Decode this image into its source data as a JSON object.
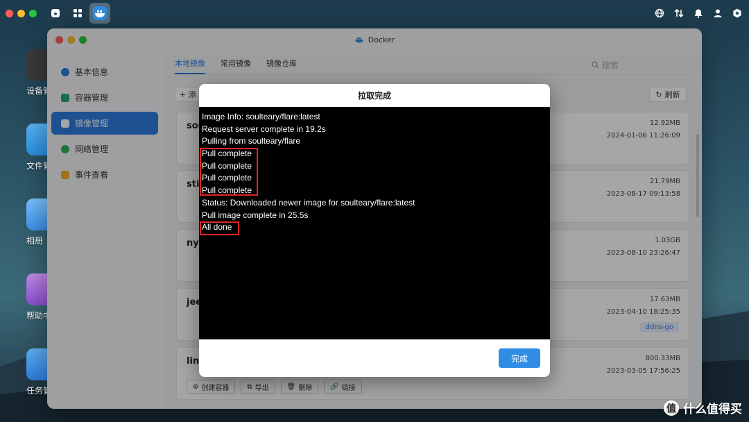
{
  "window": {
    "title": "Docker"
  },
  "desktop": {
    "icons": [
      {
        "label": "设备管"
      },
      {
        "label": "文件管"
      },
      {
        "label": "相册"
      },
      {
        "label": "帮助中"
      },
      {
        "label": "任务管"
      }
    ]
  },
  "sidebar": {
    "items": [
      {
        "label": "基本信息",
        "icon": "docker-icon"
      },
      {
        "label": "容器管理",
        "icon": "container-icon"
      },
      {
        "label": "镜像管理",
        "icon": "image-icon"
      },
      {
        "label": "网络管理",
        "icon": "network-icon"
      },
      {
        "label": "事件查看",
        "icon": "event-icon"
      }
    ]
  },
  "main": {
    "tabs": [
      {
        "label": "本地镜像"
      },
      {
        "label": "常用镜像"
      },
      {
        "label": "镜像仓库"
      }
    ],
    "search_placeholder": "搜索",
    "add_label": "添",
    "refresh_label": "刷新",
    "images": [
      {
        "name": "sou",
        "size": "12.92MB",
        "date": "2024-01-06 11:26:09",
        "tag": ""
      },
      {
        "name": "stir",
        "size": "21.79MB",
        "date": "2023-08-17 09:13:58",
        "tag": ""
      },
      {
        "name": "nya",
        "size": "1.03GB",
        "date": "2023-08-10 23:26:47",
        "tag": ""
      },
      {
        "name": "jee",
        "size": "17.63MB",
        "date": "2023-04-10 18:25:35",
        "tag": "ddns-go"
      },
      {
        "name": "linu",
        "size": "800.33MB",
        "date": "2023-03-05 17:56:25",
        "tag": ""
      }
    ],
    "actions": {
      "create": "创建容器",
      "export": "导出",
      "delete": "删除",
      "link": "链接"
    }
  },
  "dialog": {
    "title": "拉取完成",
    "log": [
      "Image Info: soulteary/flare:latest",
      "Request server complete in 19.2s",
      "Pulling from soulteary/flare",
      "Pull complete",
      "Pull complete",
      "Pull complete",
      "Pull complete",
      "Status: Downloaded newer image for soulteary/flare:latest",
      "Pull image complete in 25.5s",
      "All done"
    ],
    "ok_label": "完成"
  },
  "watermark": {
    "text": "什么值得买",
    "logo": "值"
  },
  "colors": {
    "accent": "#2f7de1",
    "highlight": "#e02424",
    "terminal_bg": "#000000"
  }
}
